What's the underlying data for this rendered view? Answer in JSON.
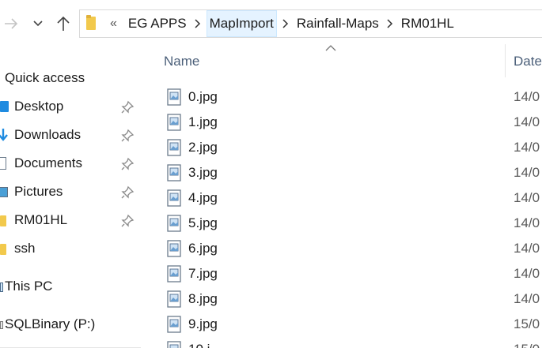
{
  "address_bar": {
    "overflow": "«",
    "crumbs": [
      "EG APPS",
      "MapImport",
      "Rainfall-Maps",
      "RM01HL"
    ]
  },
  "sidebar": {
    "quick_access": "Quick access",
    "items": [
      {
        "label": "Desktop",
        "icon": "desktop-icon",
        "pinned": true
      },
      {
        "label": "Downloads",
        "icon": "download-arrow-icon",
        "pinned": true
      },
      {
        "label": "Documents",
        "icon": "document-icon",
        "pinned": true
      },
      {
        "label": "Pictures",
        "icon": "pictures-icon",
        "pinned": true
      },
      {
        "label": "RM01HL",
        "icon": "folder-icon",
        "pinned": true
      },
      {
        "label": "ssh",
        "icon": "folder-icon",
        "pinned": false
      }
    ],
    "this_pc": "This PC",
    "drive": "SQLBinary (P:)"
  },
  "columns": {
    "name": "Name",
    "date": "Date"
  },
  "files": [
    {
      "name": "0.jpg",
      "date": "14/0"
    },
    {
      "name": "1.jpg",
      "date": "14/0"
    },
    {
      "name": "2.jpg",
      "date": "14/0"
    },
    {
      "name": "3.jpg",
      "date": "14/0"
    },
    {
      "name": "4.jpg",
      "date": "14/0"
    },
    {
      "name": "5.jpg",
      "date": "14/0"
    },
    {
      "name": "6.jpg",
      "date": "14/0"
    },
    {
      "name": "7.jpg",
      "date": "14/0"
    },
    {
      "name": "8.jpg",
      "date": "14/0"
    },
    {
      "name": "9.jpg",
      "date": "15/0"
    },
    {
      "name": "10.j",
      "date": "15/0"
    }
  ],
  "colors": {
    "accent": "#1f8be0",
    "folder": "#f2c94c",
    "header_text": "#4c607a",
    "crumb_hover": "#e5f3ff"
  }
}
